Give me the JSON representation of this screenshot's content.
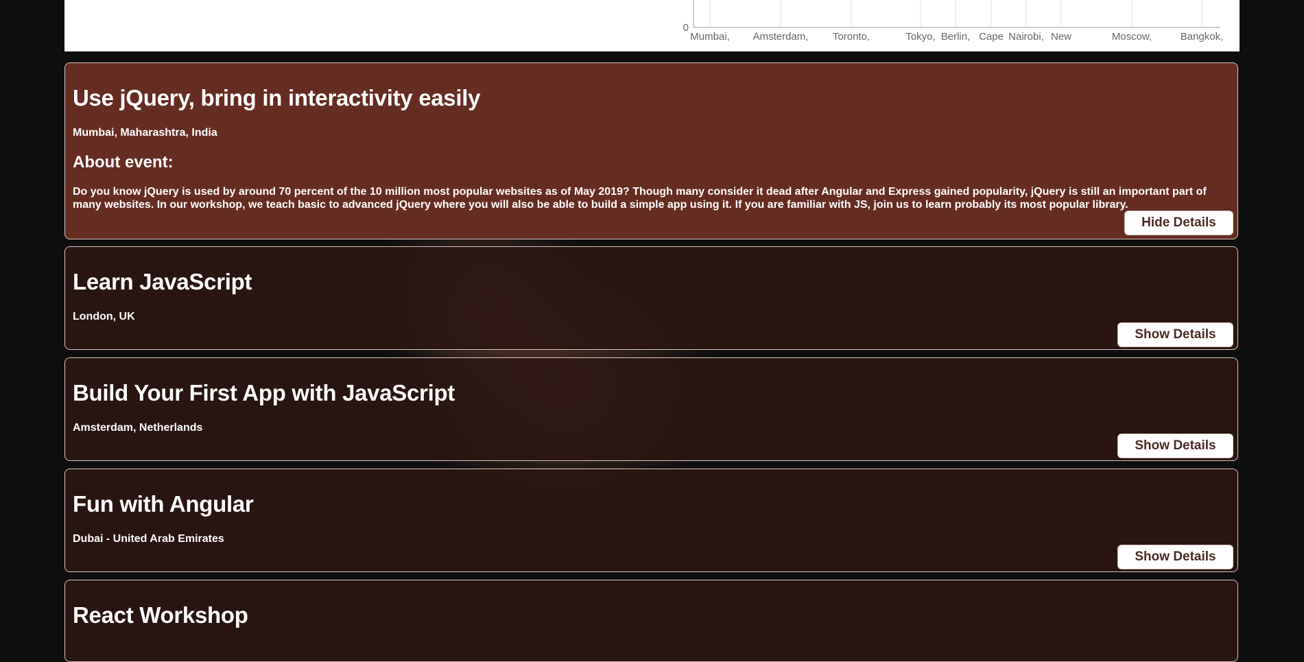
{
  "chart_data": {
    "type": "bar",
    "categories": [
      "Mumbai,",
      "Amsterdam,",
      "Toronto,",
      "Tokyo,",
      "Berlin,",
      "Cape",
      "Nairobi,",
      "New",
      "Moscow,",
      "Bangkok,"
    ],
    "y_tick_labels": [
      "0"
    ],
    "grid": true
  },
  "cards": [
    {
      "title": "Use jQuery, bring in interactivity easily",
      "location": "Mumbai, Maharashtra, India",
      "about_heading": "About event:",
      "description": "Do you know jQuery is used by around 70 percent of the 10 million most popular websites as of May 2019? Though many consider it dead after Angular and Express gained popularity, jQuery is still an important part of many websites. In our workshop, we teach basic to advanced jQuery where you will also be able to build a simple app using it. If you are familiar with JS, join us to learn probably its most popular library.",
      "button_label": "Hide Details"
    },
    {
      "title": "Learn JavaScript",
      "location": "London, UK",
      "button_label": "Show Details"
    },
    {
      "title": "Build Your First App with JavaScript",
      "location": "Amsterdam, Netherlands",
      "button_label": "Show Details"
    },
    {
      "title": "Fun with Angular",
      "location": "Dubai - United Arab Emirates",
      "button_label": "Show Details"
    },
    {
      "title": "React Workshop"
    }
  ]
}
